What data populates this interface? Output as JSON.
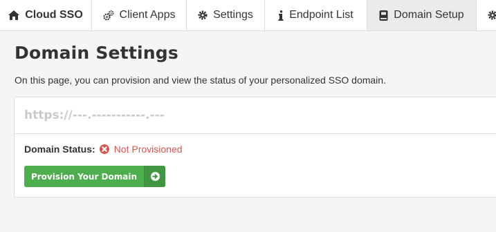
{
  "tabs": [
    {
      "label": "Cloud SSO",
      "icon": "home-icon"
    },
    {
      "label": "Client Apps",
      "icon": "cogs-icon"
    },
    {
      "label": "Settings",
      "icon": "gear-icon"
    },
    {
      "label": "Endpoint List",
      "icon": "info-icon"
    },
    {
      "label": "Domain Setup",
      "icon": "book-icon"
    },
    {
      "label": "",
      "icon": "gear-icon"
    }
  ],
  "page": {
    "title": "Domain Settings",
    "description": "On this page, you can provision and view the status of your personalized SSO domain."
  },
  "domain": {
    "url": "https://---.-----------.---",
    "status_label": "Domain Status:",
    "status_value": "Not Provisioned",
    "status_icon": "error-circle-icon",
    "status_color": "#d9534f"
  },
  "actions": {
    "provision_label": "Provision Your Domain",
    "provision_icon": "arrow-circle-right-icon"
  },
  "colors": {
    "accent_green": "#4cae4c",
    "active_tab": "#ebebeb"
  }
}
